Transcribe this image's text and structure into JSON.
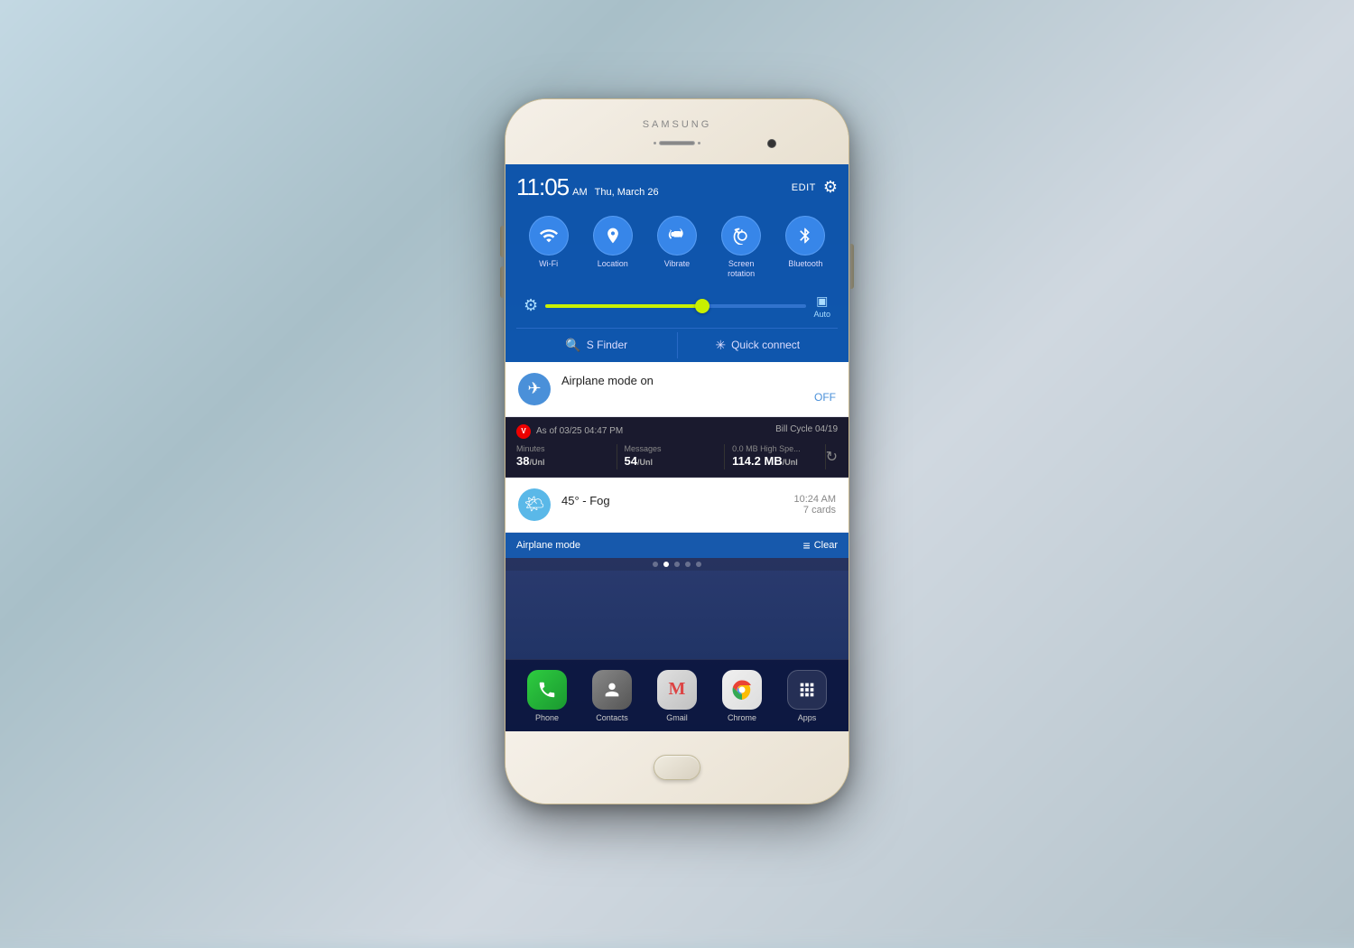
{
  "background": {
    "color": "#b8cdd6"
  },
  "phone": {
    "brand": "SAMSUNG"
  },
  "status_bar": {
    "time": "11:05",
    "ampm": "AM",
    "date": "Thu, March 26",
    "edit_label": "EDIT"
  },
  "quick_toggles": [
    {
      "id": "wifi",
      "label": "Wi-Fi",
      "icon": "📶",
      "active": true
    },
    {
      "id": "location",
      "label": "Location",
      "icon": "📍",
      "active": true
    },
    {
      "id": "vibrate",
      "label": "Vibrate",
      "icon": "📳",
      "active": true
    },
    {
      "id": "screen_rotation",
      "label": "Screen\nrotation",
      "icon": "🔄",
      "active": true
    },
    {
      "id": "bluetooth",
      "label": "Bluetooth",
      "icon": "🔵",
      "active": true
    }
  ],
  "brightness": {
    "value": 60,
    "auto_label": "Auto"
  },
  "finder_row": {
    "sfinder_label": "S Finder",
    "quick_connect_label": "Quick connect"
  },
  "notifications": [
    {
      "id": "airplane",
      "title": "Airplane mode on",
      "off_label": "OFF",
      "icon": "✈️",
      "icon_color": "blue"
    },
    {
      "id": "usage",
      "carrier": "V",
      "as_of": "As of 03/25 04:47 PM",
      "bill_cycle": "Bill Cycle 04/19",
      "stats": [
        {
          "label": "Minutes",
          "value": "38",
          "unit": "/Unl"
        },
        {
          "label": "Messages",
          "value": "54",
          "unit": "/Unl"
        },
        {
          "label": "0.0 MB High Spe...",
          "value": "114.2 MB",
          "unit": "/Unl"
        }
      ]
    },
    {
      "id": "weather",
      "title": "45° - Fog",
      "time": "10:24 AM",
      "cards": "7 cards",
      "icon": "🌤️",
      "icon_color": "sky"
    }
  ],
  "bottom_bar": {
    "label": "Airplane mode",
    "clear_label": "Clear"
  },
  "page_dots": [
    {
      "active": false
    },
    {
      "active": true
    },
    {
      "active": false
    },
    {
      "active": false
    },
    {
      "active": false
    }
  ],
  "dock": [
    {
      "id": "phone",
      "label": "Phone",
      "icon": "📞",
      "bg": "phone"
    },
    {
      "id": "contacts",
      "label": "Contacts",
      "icon": "👤",
      "bg": "contacts"
    },
    {
      "id": "gmail",
      "label": "Gmail",
      "icon": "M",
      "bg": "gmail"
    },
    {
      "id": "chrome",
      "label": "Chrome",
      "icon": "◎",
      "bg": "chrome"
    },
    {
      "id": "apps",
      "label": "Apps",
      "icon": "⠿",
      "bg": "apps"
    }
  ]
}
